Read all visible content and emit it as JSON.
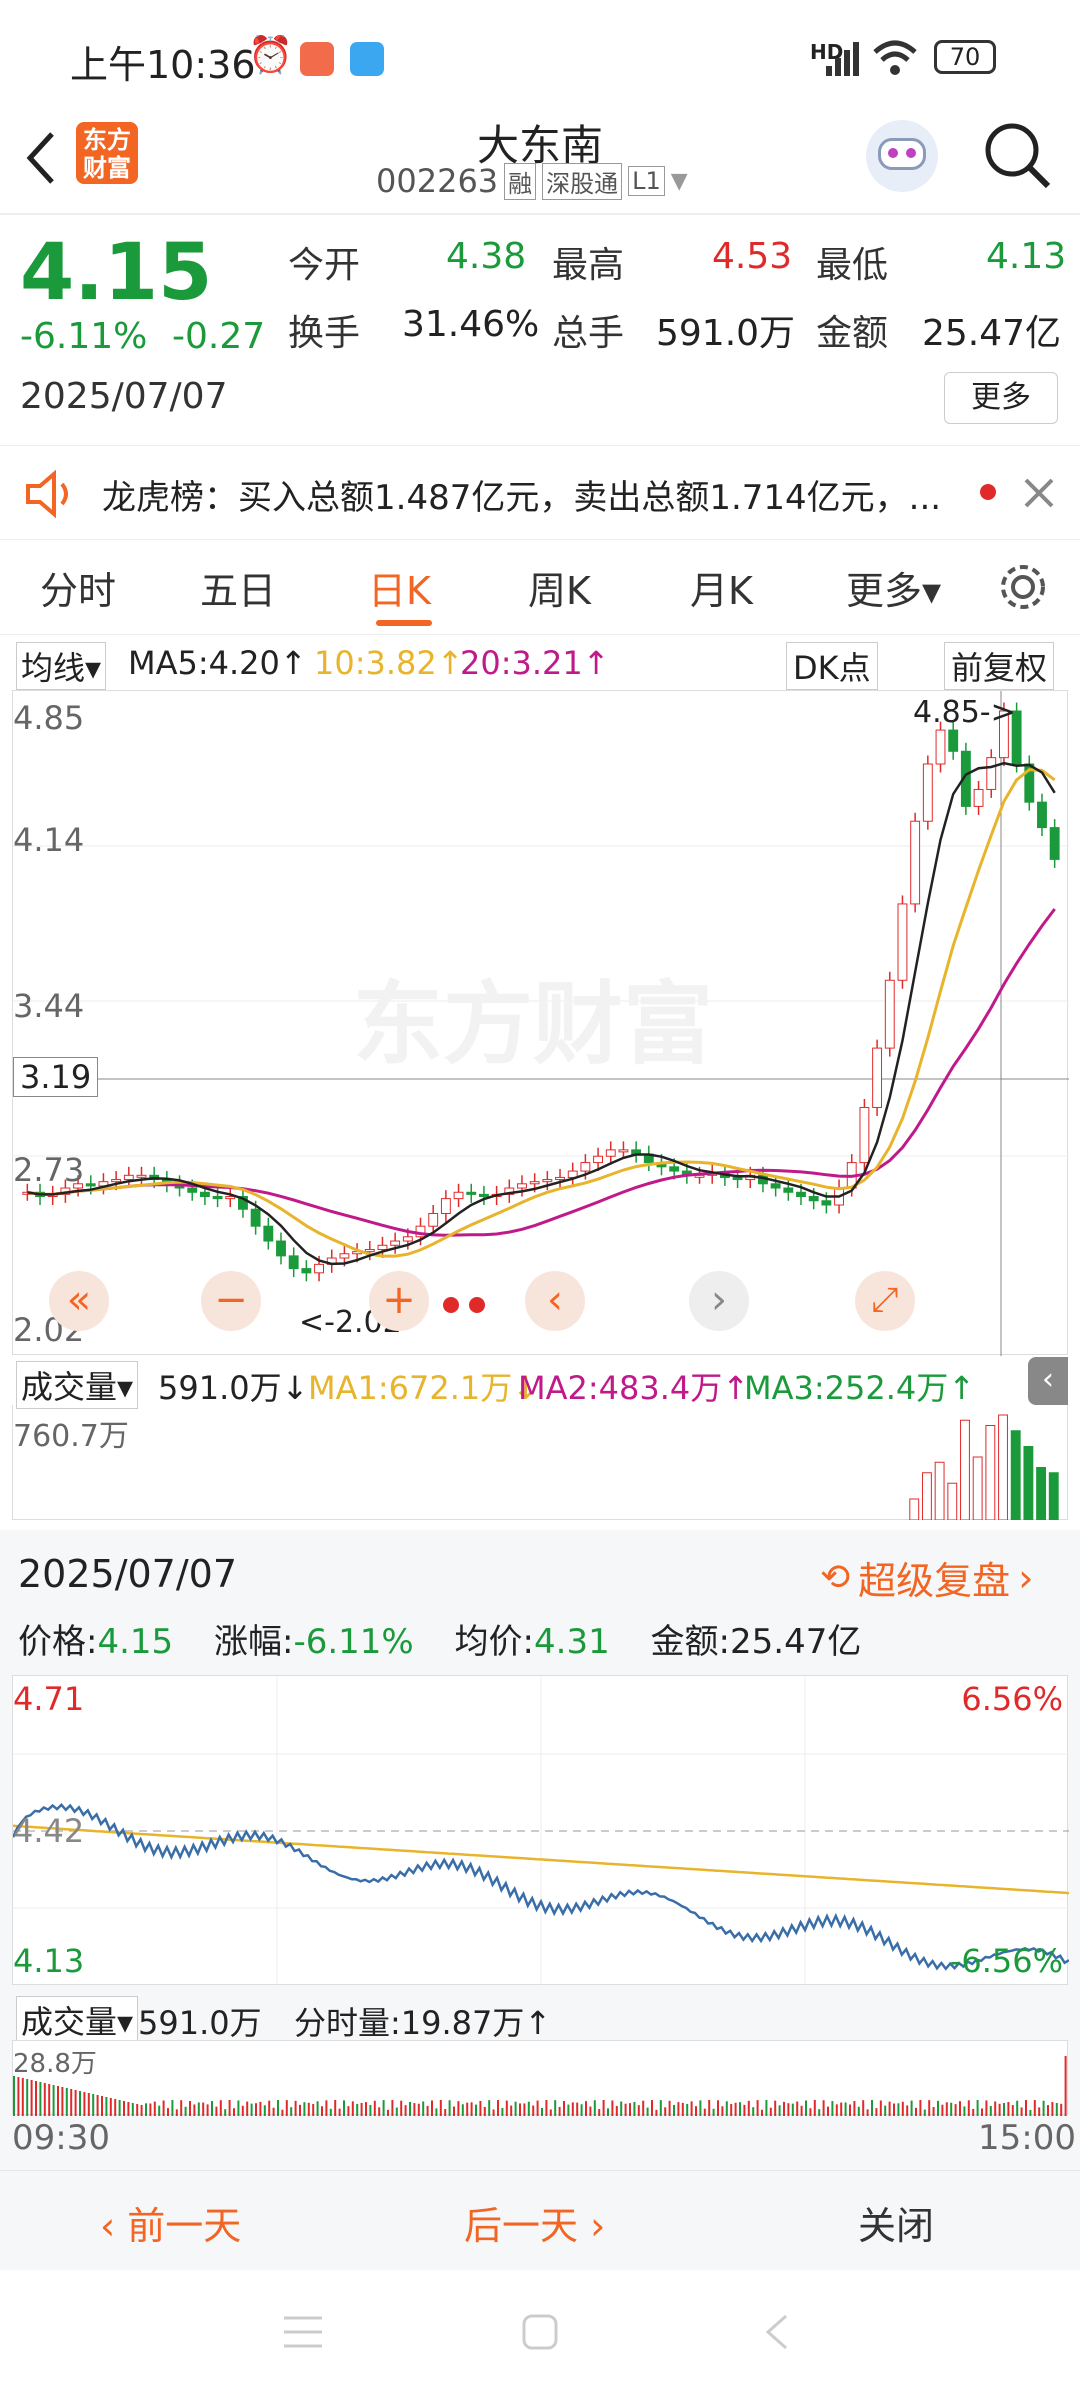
{
  "status_bar": {
    "time": "上午10:36",
    "network": "HD",
    "battery": "70"
  },
  "header": {
    "logo_text": "东方财富",
    "stock_name": "大东南",
    "stock_code": "002263",
    "tags": [
      "融",
      "深股通",
      "L1"
    ]
  },
  "quote": {
    "price": "4.15",
    "change_pct": "-6.11%",
    "change": "-0.27",
    "date": "2025/07/07",
    "open_label": "今开",
    "open": "4.38",
    "high_label": "最高",
    "high": "4.53",
    "low_label": "最低",
    "low": "4.13",
    "turnover_label": "换手",
    "turnover": "31.46%",
    "volume_label": "总手",
    "volume": "591.0万",
    "amount_label": "金额",
    "amount": "25.47亿",
    "more_label": "更多"
  },
  "notice": {
    "text": "龙虎榜：买入总额1.487亿元，卖出总额1.714亿元，..."
  },
  "tabs": [
    {
      "label": "分时"
    },
    {
      "label": "五日"
    },
    {
      "label": "日K"
    },
    {
      "label": "周K"
    },
    {
      "label": "月K"
    },
    {
      "label": "更多▾"
    }
  ],
  "active_tab": "日K",
  "ma_bar": {
    "selector": "均线▾",
    "ma5": "MA5:4.20↑",
    "ma10": "10:3.82↑",
    "ma20": "20:3.21↑",
    "dk": "DK点",
    "fq": "前复权"
  },
  "kchart": {
    "y_labels": [
      "4.85",
      "4.14",
      "3.44",
      "2.73",
      "2.02"
    ],
    "crosshair_price": "3.19",
    "max_annotation": "4.85->",
    "min_annotation": "<-2.02",
    "watermark": "东方财富"
  },
  "vol_bar": {
    "selector": "成交量▾",
    "vol": "591.0万↓",
    "ma1": "MA1:672.1万↓",
    "ma2": "MA2:483.4万↑",
    "ma3": "MA3:252.4万↑",
    "max": "760.7万"
  },
  "replay": {
    "date": "2025/07/07",
    "super_label": "超级复盘",
    "price_label": "价格:",
    "price": "4.15",
    "chg_label": "涨幅:",
    "chg": "-6.11%",
    "avg_label": "均价:",
    "avg": "4.31",
    "amt_label": "金额:",
    "amt": "25.47亿",
    "y_top": "4.71",
    "y_mid": "4.42",
    "y_bot": "4.13",
    "pct_top": "6.56%",
    "pct_bot": "-6.56%",
    "vol_label": "成交量▾",
    "vol": "591.0万",
    "tick_vol": "分时量:19.87万↑",
    "vol_max": "28.8万",
    "t_start": "09:30",
    "t_end": "15:00"
  },
  "footer": {
    "prev": "前一天",
    "next": "后一天",
    "close": "关闭"
  },
  "colors": {
    "up": "#e02a2a",
    "down": "#1a9a3a",
    "accent": "#f26522",
    "ma5": "#222222",
    "ma10": "#e8b42c",
    "ma20": "#c0198a"
  }
}
